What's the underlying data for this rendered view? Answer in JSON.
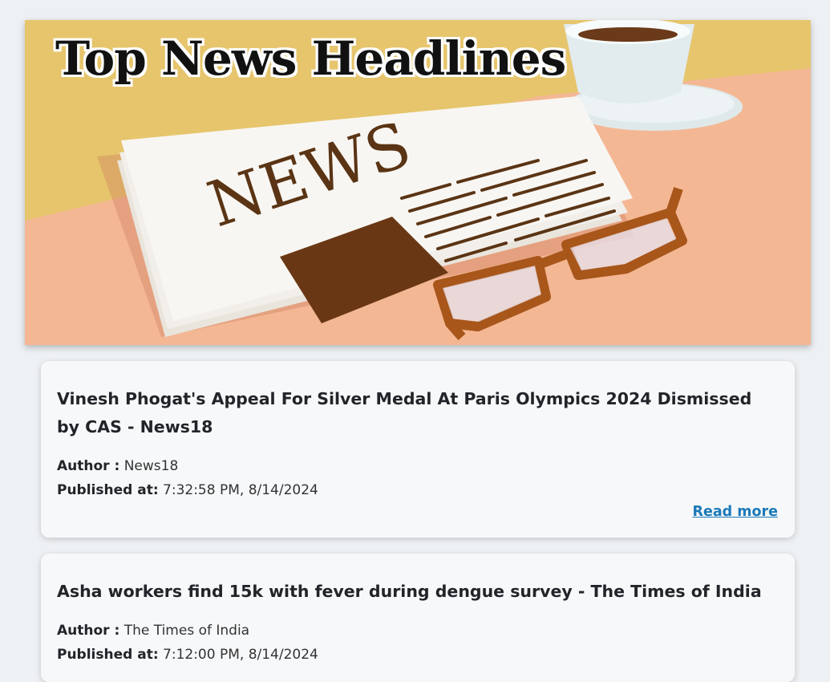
{
  "banner": {
    "title": "Top News Headlines",
    "newspaper_word": "NEWS"
  },
  "articles": [
    {
      "title": "Vinesh Phogat's Appeal For Silver Medal At Paris Olympics 2024 Dismissed by CAS - News18",
      "author_label": "Author :",
      "author": "News18",
      "published_label": "Published at:",
      "published": "7:32:58 PM, 8/14/2024",
      "read_more": "Read more"
    },
    {
      "title": "Asha workers find 15k with fever during dengue survey - The Times of India",
      "author_label": "Author :",
      "author": "The Times of India",
      "published_label": "Published at:",
      "published": "7:12:00 PM, 8/14/2024"
    }
  ],
  "colors": {
    "accent_link": "#1a7ab8",
    "page_bg": "#eef1f4",
    "card_bg": "#f7f8fa"
  }
}
